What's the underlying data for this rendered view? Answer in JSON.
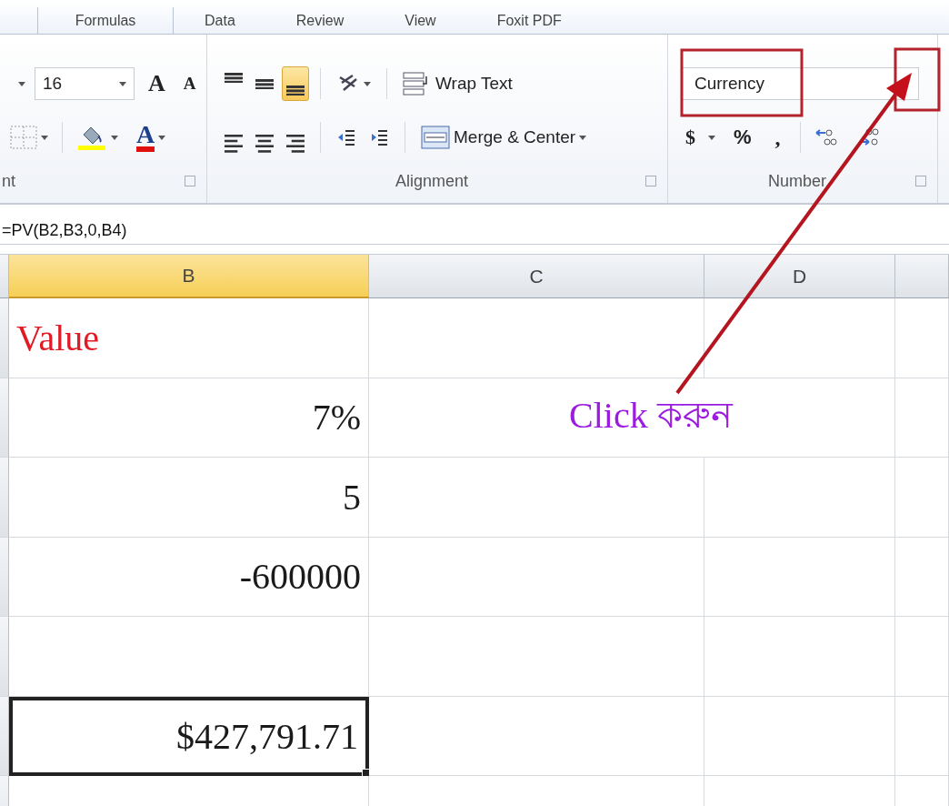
{
  "tabs": [
    {
      "label": "Formulas",
      "selected": false
    },
    {
      "label": "Data",
      "selected": false
    },
    {
      "label": "Review",
      "selected": false
    },
    {
      "label": "View",
      "selected": false
    },
    {
      "label": "Foxit PDF",
      "selected": false
    }
  ],
  "ribbon": {
    "font_size": "16",
    "grow_font_glyph": "A",
    "shrink_font_glyph": "A",
    "font_color_glyph": "A",
    "vertical_align": [
      {
        "kind": "top",
        "selected": false
      },
      {
        "kind": "middle",
        "selected": false
      },
      {
        "kind": "bottom",
        "selected": true
      }
    ],
    "horizontal_align": [
      {
        "kind": "left",
        "selected": false
      },
      {
        "kind": "center",
        "selected": false
      },
      {
        "kind": "right",
        "selected": false
      }
    ],
    "wrap_text": "Wrap Text",
    "merge_center": "Merge & Center",
    "number_format": "Currency",
    "currency_symbol": "$",
    "percent_symbol": "%",
    "comma_symbol": ",",
    "groups": [
      {
        "label": "nt"
      },
      {
        "label": "Alignment"
      },
      {
        "label": "Number"
      }
    ]
  },
  "formula_bar": {
    "value": "=PV(B2,B3,0,B4)"
  },
  "sheet": {
    "columns": [
      {
        "label": "B",
        "selected": true
      },
      {
        "label": "C",
        "selected": false
      },
      {
        "label": "D",
        "selected": false
      }
    ],
    "rows": [
      {
        "cells": [
          {
            "kind": "text",
            "text": "Value",
            "color": "#e01b24",
            "selected": false
          },
          {
            "selected": false
          }
        ]
      },
      {
        "cells": [
          {
            "kind": "number",
            "text": "7%",
            "color": "#1a1a1a",
            "selected": false
          },
          {
            "kind": "note",
            "text": "Click করুন",
            "color": "#9b1be0",
            "selected": false
          }
        ]
      },
      {
        "cells": [
          {
            "kind": "number",
            "text": "5",
            "color": "#1a1a1a",
            "selected": false
          },
          {
            "selected": false
          }
        ]
      },
      {
        "cells": [
          {
            "kind": "number",
            "text": "-600000",
            "color": "#1a1a1a",
            "selected": false
          },
          {
            "selected": false
          }
        ]
      },
      {
        "cells": [
          {
            "selected": false
          },
          {
            "selected": false
          }
        ]
      },
      {
        "cells": [
          {
            "kind": "number",
            "text": "$427,791.71",
            "color": "#1a1a1a",
            "selected": true
          },
          {
            "selected": false
          }
        ]
      },
      {
        "cells": [
          {
            "selected": false
          },
          {
            "selected": false
          }
        ]
      }
    ]
  }
}
